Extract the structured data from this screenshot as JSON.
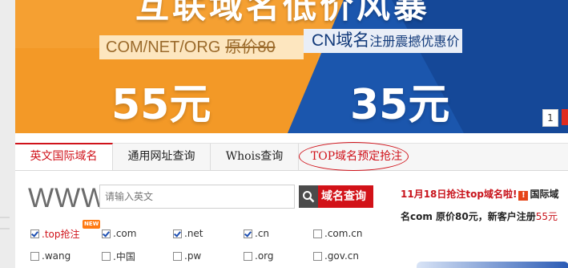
{
  "banner": {
    "title": "互联域名低价风暴",
    "com_label": "COM/NET/ORG",
    "com_old_price": "原价80",
    "cn_label": "CN域名",
    "cn_promo": "注册震撼优惠价",
    "price_left": "55元",
    "price_right": "35元",
    "slide_number": "1"
  },
  "tabs": [
    {
      "label": "英文国际域名",
      "active": true
    },
    {
      "label": "通用网址查询",
      "active": false
    },
    {
      "label": "Whois查询",
      "active": false
    },
    {
      "label": "TOP域名预定抢注",
      "active": false
    }
  ],
  "search": {
    "prefix": "WWW.",
    "placeholder": "请输入英文",
    "button_label": "域名查询"
  },
  "checkboxes": {
    "row1": [
      {
        "label": ".top抢注",
        "checked": true,
        "badge": "NEW"
      },
      {
        "label": ".com",
        "checked": true
      },
      {
        "label": ".net",
        "checked": true
      },
      {
        "label": ".cn",
        "checked": true
      },
      {
        "label": ".com.cn",
        "checked": false
      }
    ],
    "row2": [
      {
        "label": ".wang",
        "checked": false
      },
      {
        "label": ".中国",
        "checked": false
      },
      {
        "label": ".pw",
        "checked": false
      },
      {
        "label": ".org",
        "checked": false
      },
      {
        "label": ".gov.cn",
        "checked": false
      }
    ]
  },
  "news": {
    "line1_red": "11月18日抢注top域名啦!",
    "line1_icon": "!",
    "line1_rest": "国际域",
    "line2_prefix": "名com 原价80元，新客户注册",
    "line2_price": "55元"
  },
  "colors": {
    "accent_red": "#d0131b",
    "banner_orange": "#f39c28",
    "banner_blue": "#1f5fb9"
  }
}
